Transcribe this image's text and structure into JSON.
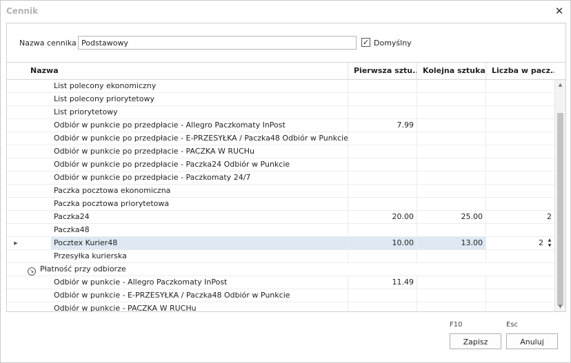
{
  "window": {
    "title": "Cennik",
    "close_glyph": "✕"
  },
  "form": {
    "name_label": "Nazwa cennika",
    "name_value": "Podstawowy",
    "default_checked": true,
    "default_label": "Domyślny"
  },
  "grid": {
    "columns": {
      "name": "Nazwa",
      "first": "Pierwsza sztu...",
      "next": "Kolejna sztuka",
      "pack": "Liczba w pacz..."
    },
    "rows": [
      {
        "name": "List polecony ekonomiczny",
        "first": "",
        "next": "",
        "pack": ""
      },
      {
        "name": "List polecony priorytetowy",
        "first": "",
        "next": "",
        "pack": ""
      },
      {
        "name": "List priorytetowy",
        "first": "",
        "next": "",
        "pack": ""
      },
      {
        "name": "Odbiór w punkcie po przedpłacie - Allegro Paczkomaty InPost",
        "first": "7.99",
        "next": "",
        "pack": ""
      },
      {
        "name": "Odbiór w punkcie po przedpłacie - E-PRZESYŁKA / Paczka48 Odbiór w Punkcie",
        "first": "",
        "next": "",
        "pack": ""
      },
      {
        "name": "Odbiór w punkcie po przedpłacie - PACZKA W RUCHu",
        "first": "",
        "next": "",
        "pack": ""
      },
      {
        "name": "Odbiór w punkcie po przedpłacie - Paczka24 Odbiór w Punkcie",
        "first": "",
        "next": "",
        "pack": ""
      },
      {
        "name": "Odbiór w punkcie po przedpłacie - Paczkomaty 24/7",
        "first": "",
        "next": "",
        "pack": ""
      },
      {
        "name": "Paczka pocztowa ekonomiczna",
        "first": "",
        "next": "",
        "pack": ""
      },
      {
        "name": "Paczka pocztowa priorytetowa",
        "first": "",
        "next": "",
        "pack": ""
      },
      {
        "name": "Paczka24",
        "first": "20.00",
        "next": "25.00",
        "pack": "2"
      },
      {
        "name": "Paczka48",
        "first": "",
        "next": "",
        "pack": ""
      },
      {
        "name": "Pocztex Kurier48",
        "first": "10.00",
        "next": "13.00",
        "pack": "2",
        "selected": true
      },
      {
        "name": "Przesyłka kurierska",
        "first": "",
        "next": "",
        "pack": ""
      },
      {
        "name": "Płatność przy odbiorze",
        "group": true
      },
      {
        "name": "Odbiór w punkcie - Allegro Paczkomaty InPost",
        "first": "11.49",
        "next": "",
        "pack": ""
      },
      {
        "name": "Odbiór w punkcie - E-PRZESYŁKA / Paczka48 Odbiór w Punkcie",
        "first": "",
        "next": "",
        "pack": ""
      },
      {
        "name": "Odbiór w punkcie - PACZKA W RUCHu",
        "first": "",
        "next": "",
        "pack": ""
      }
    ]
  },
  "footer": {
    "save_key": "F10",
    "cancel_key": "Esc",
    "save_label": "Zapisz",
    "cancel_label": "Anuluj"
  },
  "icons": {
    "row_indicator": "triangle-right-icon",
    "group_toggle": "circle-arrow-icon",
    "scroll_up": "triangle-up-icon",
    "scroll_down": "triangle-down-icon"
  }
}
